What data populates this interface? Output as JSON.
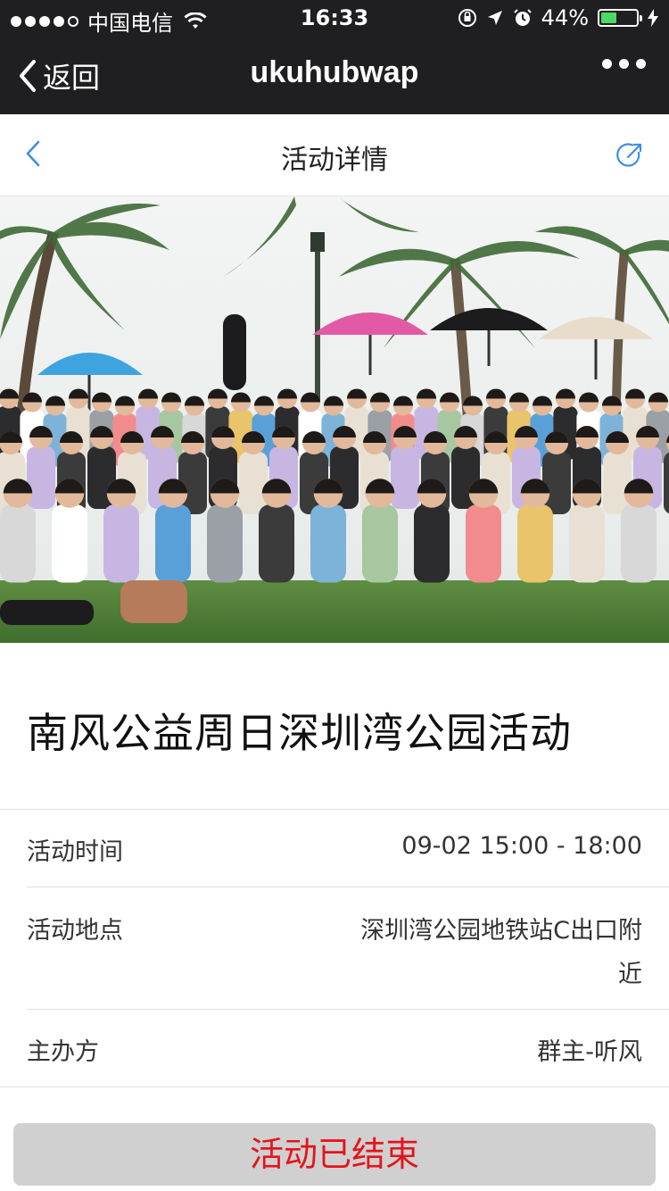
{
  "status_bar": {
    "carrier": "中国电信",
    "time": "16:33",
    "battery": "44%",
    "battery_level": 0.44,
    "battery_color": "#4cd964"
  },
  "navbar": {
    "back_label": "返回",
    "title": "ukuhubwap"
  },
  "page_header": {
    "title": "活动详情",
    "accent": "#3b8ee8"
  },
  "event": {
    "title": "南风公益周日深圳湾公园活动",
    "fields": [
      {
        "label": "活动时间",
        "value": "09-02 15:00 - 18:00"
      },
      {
        "label": "活动地点",
        "value_line1": "深圳湾公园地铁站C出口附",
        "value_line2": "近"
      },
      {
        "label": "主办方",
        "value": "群主-听风"
      }
    ]
  },
  "action": {
    "status_label": "活动已结束",
    "label_color": "#e5141b"
  }
}
